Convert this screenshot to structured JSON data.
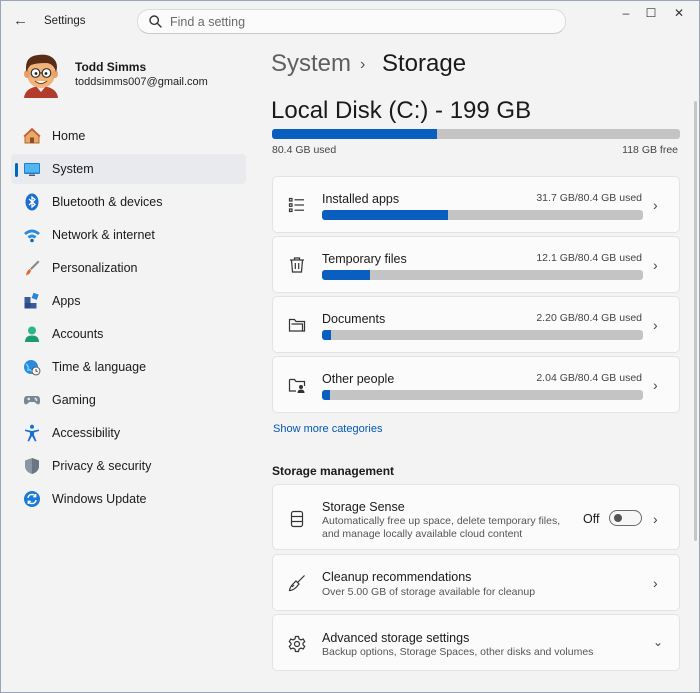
{
  "window": {
    "app_title": "Settings",
    "back_glyph": "←",
    "minimize_glyph": "–",
    "maximize_glyph": "☐",
    "close_glyph": "✕"
  },
  "search": {
    "placeholder": "Find a setting"
  },
  "profile": {
    "name": "Todd Simms",
    "email": "toddsimms007@gmail.com"
  },
  "nav": {
    "selected": "System",
    "items": [
      {
        "label": "Home",
        "icon": "home-icon"
      },
      {
        "label": "System",
        "icon": "monitor-icon"
      },
      {
        "label": "Bluetooth & devices",
        "icon": "bluetooth-icon"
      },
      {
        "label": "Network & internet",
        "icon": "wifi-icon"
      },
      {
        "label": "Personalization",
        "icon": "paintbrush-icon"
      },
      {
        "label": "Apps",
        "icon": "apps-icon"
      },
      {
        "label": "Accounts",
        "icon": "person-icon"
      },
      {
        "label": "Time & language",
        "icon": "globe-clock-icon"
      },
      {
        "label": "Gaming",
        "icon": "gamepad-icon"
      },
      {
        "label": "Accessibility",
        "icon": "accessibility-icon"
      },
      {
        "label": "Privacy & security",
        "icon": "shield-icon"
      },
      {
        "label": "Windows Update",
        "icon": "refresh-icon"
      }
    ]
  },
  "breadcrumb": {
    "parent": "System",
    "separator": "›",
    "current": "Storage"
  },
  "disk": {
    "title": "Local Disk (C:) - 199 GB",
    "used_label": "80.4 GB used",
    "free_label": "118 GB free",
    "used_fraction": 0.404
  },
  "categories": [
    {
      "name": "Installed apps",
      "usage": "31.7 GB/80.4 GB used",
      "fraction": 0.394,
      "icon": "list-icon"
    },
    {
      "name": "Temporary files",
      "usage": "12.1 GB/80.4 GB used",
      "fraction": 0.15,
      "icon": "trash-icon"
    },
    {
      "name": "Documents",
      "usage": "2.20 GB/80.4 GB used",
      "fraction": 0.027,
      "icon": "folder-icon"
    },
    {
      "name": "Other people",
      "usage": "2.04 GB/80.4 GB used",
      "fraction": 0.025,
      "icon": "people-folder-icon"
    }
  ],
  "show_more_label": "Show more categories",
  "storage_management": {
    "title": "Storage management",
    "items": [
      {
        "name": "Storage Sense",
        "desc_line1": "Automatically free up space, delete temporary files,",
        "desc_line2": "and manage locally available cloud content",
        "toggle_label": "Off",
        "toggle_on": false,
        "icon": "storage-drive-icon"
      },
      {
        "name": "Cleanup recommendations",
        "desc_line1": "Over 5.00 GB of storage available for cleanup",
        "icon": "broom-icon"
      },
      {
        "name": "Advanced storage settings",
        "desc_line1": "Backup options, Storage Spaces, other disks and volumes",
        "icon": "gear-icon"
      }
    ]
  },
  "colors": {
    "accent": "#0a5ebf",
    "bar_track": "#c4c4c4",
    "link": "#0058b3"
  }
}
